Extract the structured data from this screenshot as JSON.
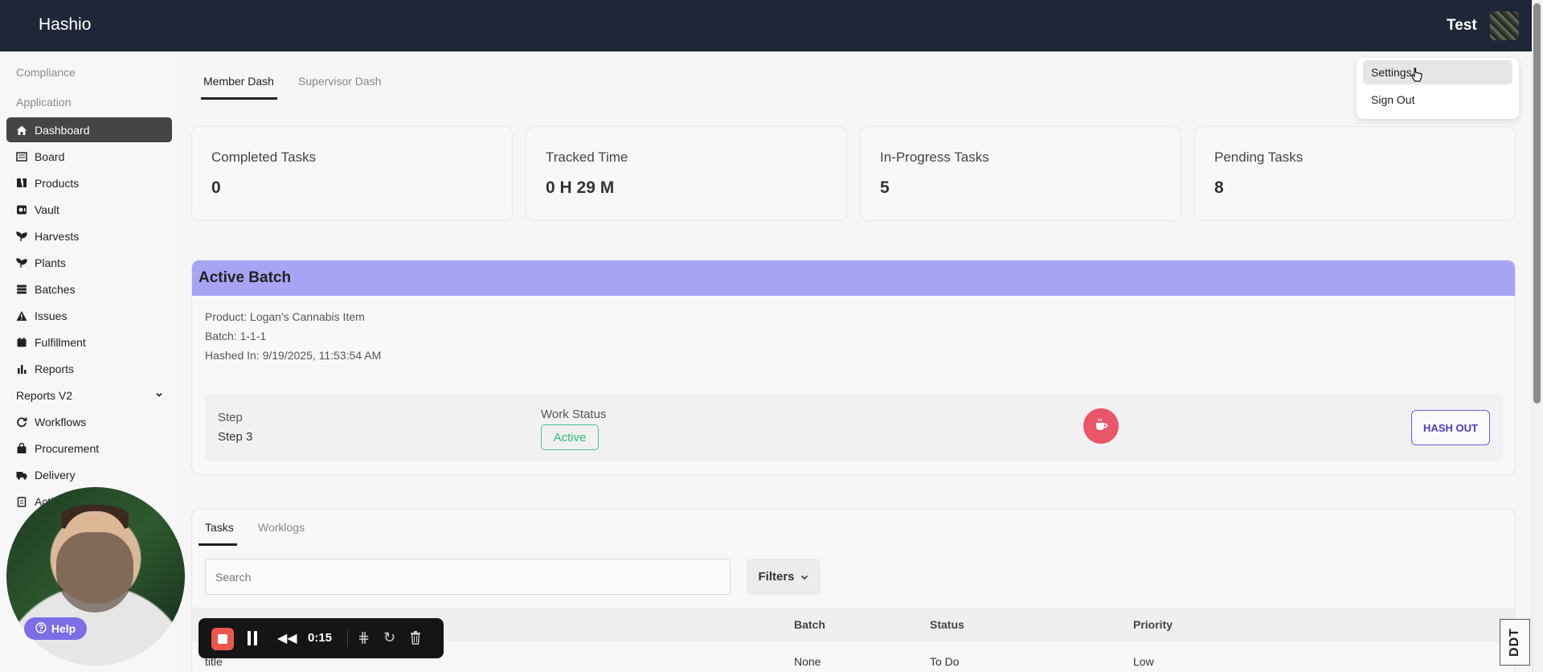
{
  "app": {
    "title": "Hashio",
    "user": "Test"
  },
  "sidebar": {
    "sections": [
      "Compliance",
      "Application"
    ],
    "items": [
      {
        "label": "Dashboard",
        "icon": "home-icon"
      },
      {
        "label": "Board",
        "icon": "board-icon"
      },
      {
        "label": "Products",
        "icon": "flask-icon"
      },
      {
        "label": "Vault",
        "icon": "vault-icon"
      },
      {
        "label": "Harvests",
        "icon": "sprout-icon"
      },
      {
        "label": "Plants",
        "icon": "sprout-icon"
      },
      {
        "label": "Batches",
        "icon": "stack-icon"
      },
      {
        "label": "Issues",
        "icon": "warning-icon"
      },
      {
        "label": "Fulfillment",
        "icon": "calendar-icon"
      },
      {
        "label": "Reports",
        "icon": "bar-chart-icon"
      },
      {
        "label": "Reports V2",
        "icon": "chevron-down-icon"
      },
      {
        "label": "Workflows",
        "icon": "workflow-icon"
      },
      {
        "label": "Procurement",
        "icon": "bag-icon"
      },
      {
        "label": "Delivery",
        "icon": "truck-icon"
      },
      {
        "label": "Acti",
        "icon": "clipboard-icon"
      }
    ]
  },
  "dash_tabs": [
    "Member Dash",
    "Supervisor Dash"
  ],
  "stats": [
    {
      "label": "Completed Tasks",
      "value": "0"
    },
    {
      "label": "Tracked Time",
      "value": "0 H 29 M"
    },
    {
      "label": "In-Progress Tasks",
      "value": "5"
    },
    {
      "label": "Pending Tasks",
      "value": "8"
    }
  ],
  "active_batch": {
    "title": "Active Batch",
    "product": "Product: Logan's Cannabis Item",
    "batch": "Batch: 1-1-1",
    "hashed_in": "Hashed In: 9/19/2025, 11:53:54 AM",
    "step_label": "Step",
    "step_value": "Step 3",
    "work_status_label": "Work Status",
    "work_status": "Active",
    "hash_out": "HASH OUT"
  },
  "tasks": {
    "tabs": [
      "Tasks",
      "Worklogs"
    ],
    "search_placeholder": "Search",
    "filters": "Filters",
    "columns": [
      "Batch",
      "Status",
      "Priority"
    ],
    "rows": [
      {
        "title": "title",
        "batch": "None",
        "status": "To Do",
        "priority": "Low"
      }
    ]
  },
  "user_menu": {
    "settings": "Settings",
    "sign_out": "Sign Out"
  },
  "help": "Help",
  "recorder": {
    "time": "0:15"
  },
  "watermark": "DDT",
  "colors": {
    "topbar": "#1e2737",
    "active_batch_header": "#a8a4f4",
    "active_status": "#2ebf7a",
    "break_button": "#e9566a",
    "hash_out": "#4b3ec4"
  }
}
